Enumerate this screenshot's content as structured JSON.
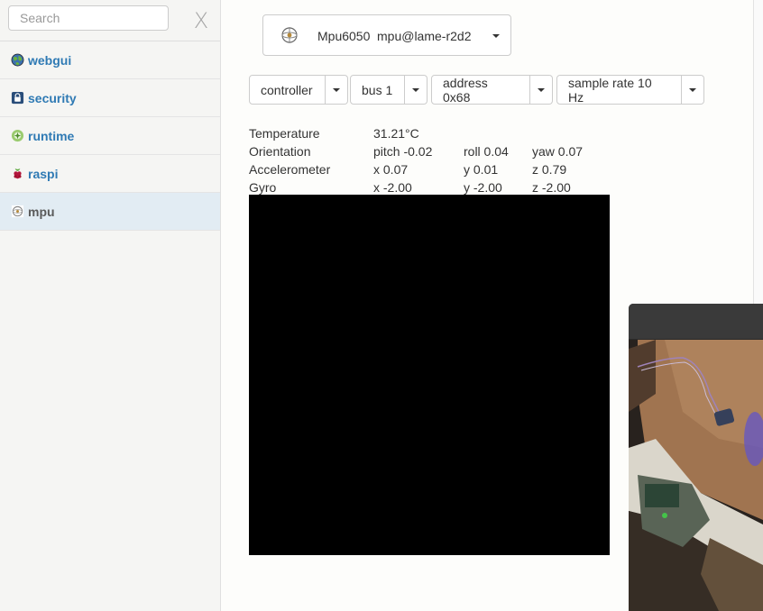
{
  "search": {
    "placeholder": "Search",
    "clear_label": "X"
  },
  "sidebar": {
    "items": [
      {
        "label": "webgui",
        "icon": "globe-icon"
      },
      {
        "label": "security",
        "icon": "lock-icon"
      },
      {
        "label": "runtime",
        "icon": "runtime-icon"
      },
      {
        "label": "raspi",
        "icon": "raspberry-icon"
      },
      {
        "label": "mpu",
        "icon": "gyroscope-icon",
        "active": true
      }
    ]
  },
  "device": {
    "name": "Mpu6050",
    "host": "mpu@lame-r2d2"
  },
  "controls": [
    {
      "label": "controller"
    },
    {
      "label": "bus 1"
    },
    {
      "label": "address 0x68"
    },
    {
      "label": "sample rate 10 Hz"
    }
  ],
  "readings": {
    "temperature": {
      "label": "Temperature",
      "value": "31.21°C"
    },
    "orientation": {
      "label": "Orientation",
      "pitch": "pitch -0.02",
      "roll": "roll 0.04",
      "yaw": "yaw 0.07"
    },
    "accelerometer": {
      "label": "Accelerometer",
      "x": "x 0.07",
      "y": "y 0.01",
      "z": "z 0.79"
    },
    "gyro": {
      "label": "Gyro",
      "x": "x -2.00",
      "y": "y -2.00",
      "z": "z -2.00"
    }
  },
  "colors": {
    "link": "#2f7ab4",
    "active_bg": "#e2ecf3",
    "canvas": "#000000"
  }
}
